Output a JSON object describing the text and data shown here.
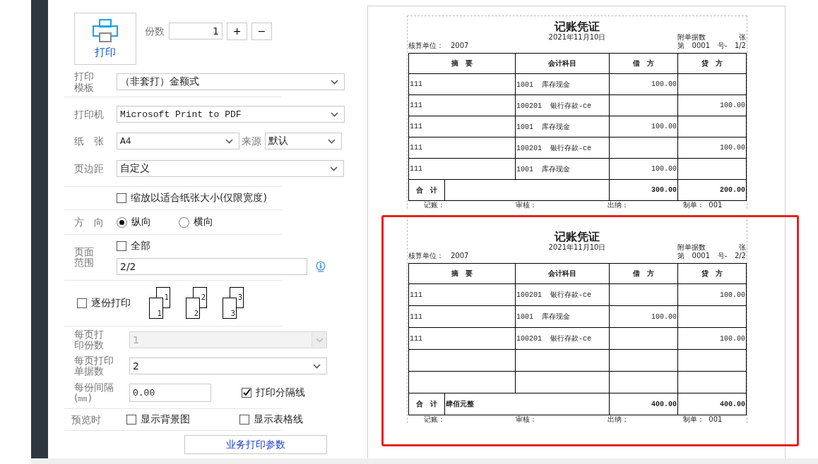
{
  "print_button": {
    "label": "打印"
  },
  "copies": {
    "label": "份数",
    "value": "1",
    "increment": "+",
    "decrement": "−"
  },
  "template": {
    "label": "打印模板",
    "value": "（非套打）金额式"
  },
  "printer": {
    "label": "打印机",
    "value": "Microsoft Print to PDF"
  },
  "paper": {
    "label": "纸　张",
    "value": "A4",
    "source_label": "来源",
    "source_value": "默认"
  },
  "margin": {
    "label": "页边距",
    "value": "自定义"
  },
  "fit_width": {
    "label": "缩放以适合纸张大小(仅限宽度)",
    "checked": false
  },
  "orientation": {
    "label": "方　向",
    "options": [
      {
        "label": "纵向",
        "selected": true
      },
      {
        "label": "横向",
        "selected": false
      }
    ]
  },
  "page_range": {
    "label": "页面范围",
    "all": {
      "label": "全部",
      "checked": false
    },
    "value": "2/2"
  },
  "collate": {
    "label": "逐份打印",
    "checked": false,
    "pages": [
      {
        "back": "1",
        "front": "1"
      },
      {
        "back": "2",
        "front": "2"
      },
      {
        "back": "3",
        "front": "3"
      }
    ]
  },
  "per_page_copies": {
    "label": "每页打印份数",
    "value": "1",
    "disabled": true
  },
  "per_page_vouchers": {
    "label": "每页打印单据数",
    "value": "2",
    "disabled": false
  },
  "interval": {
    "label": "每份间隔(㎜)",
    "value": "0.00"
  },
  "print_separator": {
    "label": "打印分隔线",
    "checked": true
  },
  "preview": {
    "label": "预览时",
    "options": [
      {
        "label": "显示背景图",
        "checked": false
      },
      {
        "label": "显示表格线",
        "checked": false
      }
    ]
  },
  "business_button": {
    "label": "业务打印参数"
  },
  "vouchers": [
    {
      "title": "记账凭证",
      "date": "2021年11月10日",
      "attachments_label": "附单据数",
      "attachments_unit": "张",
      "unit_label": "核算单位：",
      "unit": "2007",
      "number_prefix": "第",
      "number": "0001",
      "number_suffix": "号-",
      "page": "1/2",
      "columns": [
        "摘　要",
        "会计科目",
        "借　方",
        "贷　方"
      ],
      "rows": [
        {
          "kind": "entry",
          "summary": "111",
          "account": "1001  库存现金",
          "debit": "100.00"
        },
        {
          "kind": "entry",
          "summary": "111",
          "account": "100201  银行存款-ce",
          "credit": "100.00"
        },
        {
          "kind": "entry",
          "summary": "111",
          "account": "1001  库存现金",
          "debit": "100.00"
        },
        {
          "kind": "entry",
          "summary": "111",
          "account": "100201  银行存款-ce",
          "credit": "100.00"
        },
        {
          "kind": "entry",
          "summary": "111",
          "account": "1001  库存现金",
          "debit": "100.00"
        }
      ],
      "total": {
        "label": "合　计",
        "debit": "300.00",
        "credit": "200.00"
      },
      "footer": [
        "记账：",
        "审核：",
        "出纳：",
        "制单：  001"
      ]
    },
    {
      "title": "记账凭证",
      "date": "2021年11月10日",
      "attachments_label": "附单据数",
      "attachments_unit": "张",
      "unit_label": "核算单位：",
      "unit": "2007",
      "number_prefix": "第",
      "number": "0001",
      "number_suffix": "号-",
      "page": "2/2",
      "columns": [
        "摘　要",
        "会计科目",
        "借　方",
        "贷　方"
      ],
      "rows": [
        {
          "kind": "entry",
          "summary": "111",
          "account": "100201  银行存款-ce",
          "credit": "100.00"
        },
        {
          "kind": "entry",
          "summary": "111",
          "account": "1001  库存现金",
          "debit": "100.00"
        },
        {
          "kind": "entry",
          "summary": "111",
          "account": "100201  银行存款-ce",
          "credit": "100.00"
        },
        {
          "kind": "blank"
        },
        {
          "kind": "blank"
        }
      ],
      "total": {
        "label": "合　计",
        "amount_words": "肆佰元整",
        "debit": "400.00",
        "credit": "400.00"
      },
      "footer": [
        "记账：",
        "审核：",
        "出纳：",
        "制单：  001"
      ]
    }
  ]
}
